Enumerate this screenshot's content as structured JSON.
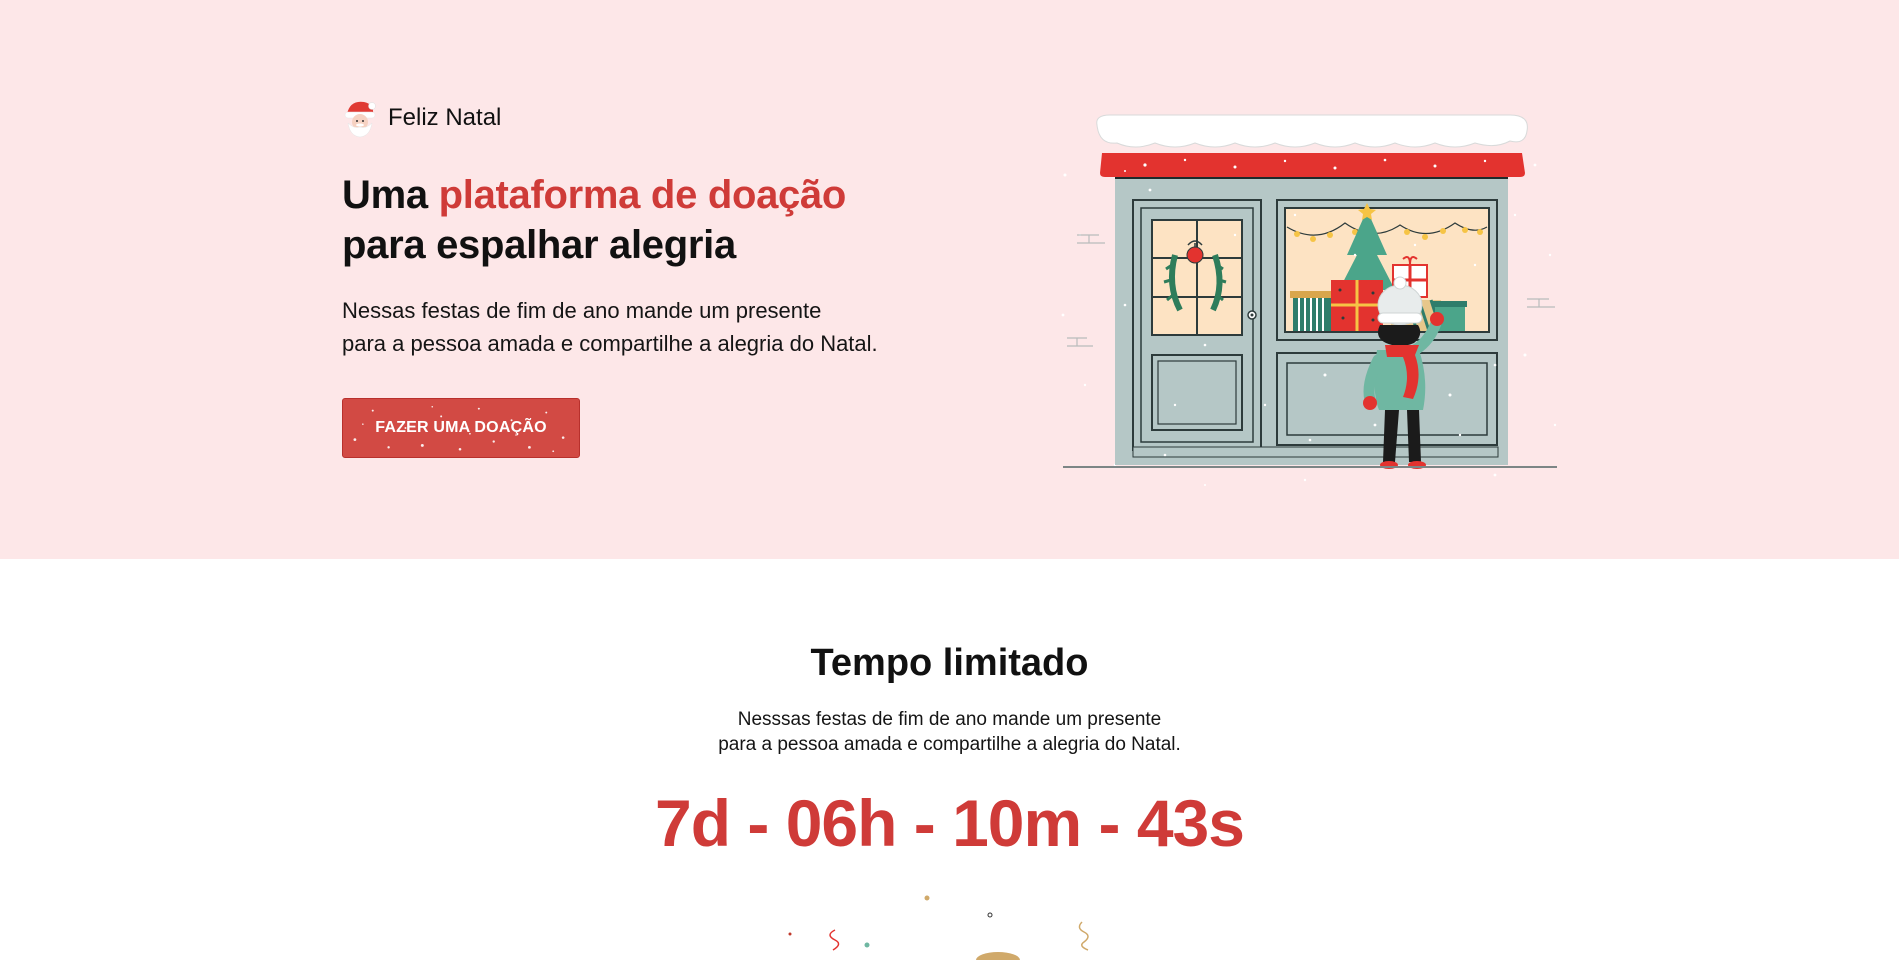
{
  "brand": {
    "name": "Feliz Natal",
    "icon": "santa-icon"
  },
  "hero": {
    "headline_start": "Uma ",
    "headline_accent": "plataforma de doação",
    "headline_end": "para espalhar alegria",
    "lead_line1": "Nessas festas de fim de ano mande um presente",
    "lead_line2": "para a pessoa amada e compartilhe a alegria do Natal.",
    "cta_label": "FAZER UMA DOAÇÃO",
    "illustration": "christmas-shop-window-illustration"
  },
  "countdown_section": {
    "title": "Tempo limitado",
    "text_line1": "Nesssas festas de fim de ano mande um presente",
    "text_line2": "para a pessoa amada e compartilhe a alegria do Natal.",
    "timer": "7d - 06h - 10m - 43s"
  },
  "colors": {
    "hero_bg": "#fde7e8",
    "accent": "#cf3b38",
    "button": "#d24a44",
    "page_bg": "#ffffff"
  }
}
